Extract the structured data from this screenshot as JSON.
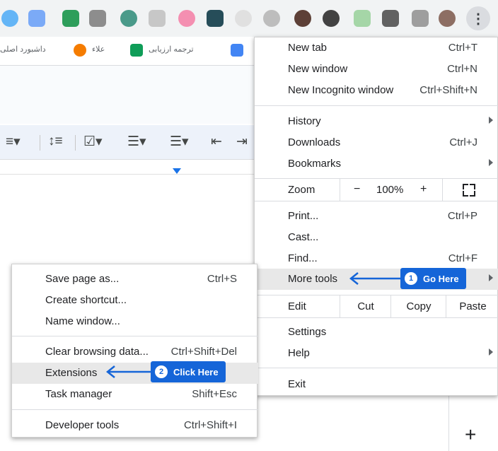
{
  "colors": {
    "accent": "#1565d8",
    "menu_highlight": "#e8e8e8",
    "docs_toolbar": "#edf2fa"
  },
  "bookmarks": [
    {
      "label": "داشبورد اصلی",
      "icon": "bookmark-icon"
    },
    {
      "label": "علاء",
      "icon": "orange-bookmark-icon"
    },
    {
      "label": "ترجمه ارزیابی",
      "icon": "sheets-icon"
    }
  ],
  "menu": {
    "new_tab": {
      "label": "New tab",
      "shortcut": "Ctrl+T"
    },
    "new_window": {
      "label": "New window",
      "shortcut": "Ctrl+N"
    },
    "new_incognito": {
      "label": "New Incognito window",
      "shortcut": "Ctrl+Shift+N"
    },
    "history": {
      "label": "History"
    },
    "downloads": {
      "label": "Downloads",
      "shortcut": "Ctrl+J"
    },
    "bookmarks": {
      "label": "Bookmarks"
    },
    "zoom": {
      "label": "Zoom",
      "minus": "−",
      "value": "100%",
      "plus": "+"
    },
    "print": {
      "label": "Print...",
      "shortcut": "Ctrl+P"
    },
    "cast": {
      "label": "Cast..."
    },
    "find": {
      "label": "Find...",
      "shortcut": "Ctrl+F"
    },
    "more_tools": {
      "label": "More tools"
    },
    "edit": {
      "label": "Edit",
      "cut": "Cut",
      "copy": "Copy",
      "paste": "Paste"
    },
    "settings": {
      "label": "Settings"
    },
    "help": {
      "label": "Help"
    },
    "exit": {
      "label": "Exit"
    }
  },
  "submenu": {
    "save_page": {
      "label": "Save page as...",
      "shortcut": "Ctrl+S"
    },
    "create_shortcut": {
      "label": "Create shortcut..."
    },
    "name_window": {
      "label": "Name window..."
    },
    "clear_data": {
      "label": "Clear browsing data...",
      "shortcut": "Ctrl+Shift+Del"
    },
    "extensions": {
      "label": "Extensions"
    },
    "task_manager": {
      "label": "Task manager",
      "shortcut": "Shift+Esc"
    },
    "developer_tools": {
      "label": "Developer tools",
      "shortcut": "Ctrl+Shift+I"
    }
  },
  "callouts": {
    "step1": {
      "number": "1",
      "text": "Go Here"
    },
    "step2": {
      "number": "2",
      "text": "Click Here"
    }
  },
  "kebab_glyph": "⋮",
  "new_plus_glyph": "+"
}
